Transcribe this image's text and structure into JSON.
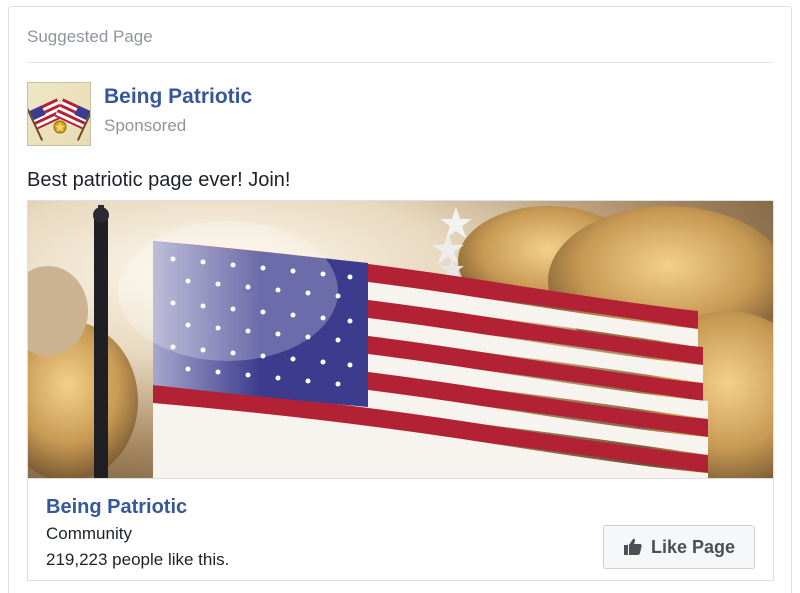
{
  "card": {
    "header": "Suggested Page",
    "page_name": "Being Patriotic",
    "sponsored_label": "Sponsored",
    "post_text": "Best patriotic page ever! Join!",
    "avatar_icon": "flags-avatar-icon",
    "hero_image": "american-flag-image"
  },
  "footer": {
    "page_name": "Being Patriotic",
    "category": "Community",
    "likes_text": "219,223 people like this.",
    "like_button_label": "Like Page",
    "like_icon": "thumbs-up-icon"
  },
  "colors": {
    "link_blue": "#365899",
    "muted_gray": "#90949c",
    "text_dark": "#1d2129",
    "button_bg": "#f6f7f9",
    "flag_red": "#b22234",
    "flag_blue": "#3c3b8e"
  }
}
